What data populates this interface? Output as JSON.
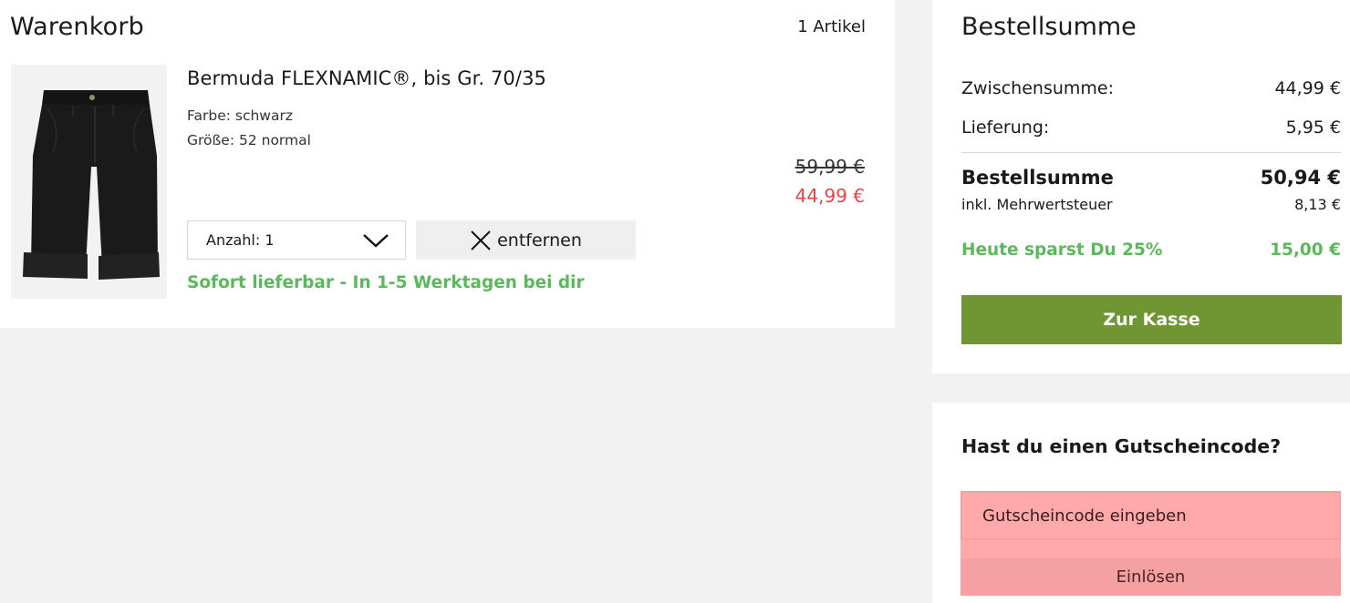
{
  "cart": {
    "title": "Warenkorb",
    "item_count": "1 Artikel",
    "items": [
      {
        "name": "Bermuda FLEXNAMIC®, bis Gr. 70/35",
        "color": "Farbe: schwarz",
        "size": "Größe: 52 normal",
        "old_price": "59,99 €",
        "price": "44,99 €",
        "quantity_label": "Anzahl: 1",
        "remove_label": "entfernen",
        "availability": "Sofort lieferbar - In 1-5 Werktagen bei dir",
        "image_icon": "black-bermuda-shorts"
      }
    ]
  },
  "summary": {
    "title": "Bestellsumme",
    "subtotal_label": "Zwischensumme:",
    "subtotal_value": "44,99 €",
    "delivery_label": "Lieferung:",
    "delivery_value": "5,95 €",
    "total_label": "Bestellsumme",
    "total_value": "50,94 €",
    "vat_label": "inkl. Mehrwertsteuer",
    "vat_value": "8,13 €",
    "savings_label": "Heute sparst Du 25%",
    "savings_value": "15,00 €",
    "checkout_label": "Zur Kasse"
  },
  "coupon": {
    "title": "Hast du einen Gutscheincode?",
    "placeholder": "Gutscheincode eingeben",
    "redeem_label": "Einlösen"
  },
  "colors": {
    "accent_green": "#6f9632",
    "availability_green": "#5cb85c",
    "sale_red": "#e0474c",
    "coupon_error_bg": "#ffa9ab"
  }
}
